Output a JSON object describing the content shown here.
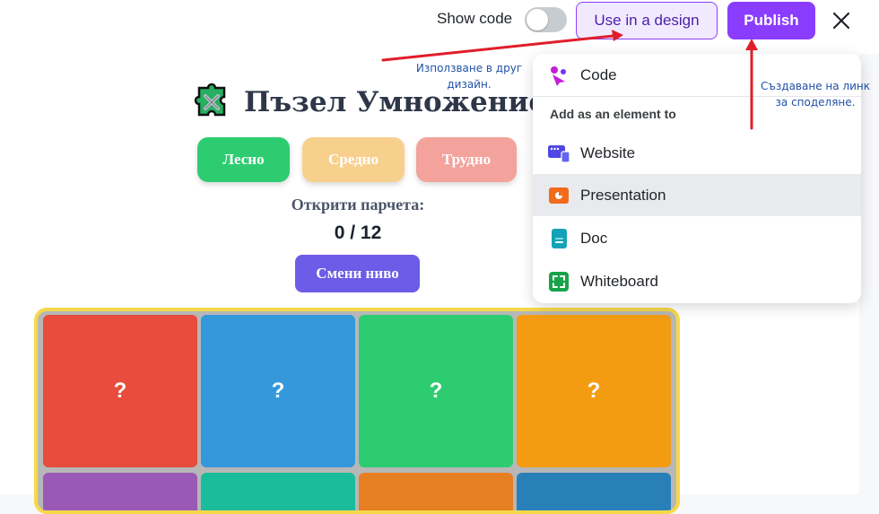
{
  "topbar": {
    "show_code_label": "Show code",
    "use_in_design_label": "Use in a design",
    "publish_label": "Publish",
    "close_icon": "close-icon",
    "colors": {
      "accent": "#8b3dff",
      "accent_soft": "#f1eaff"
    }
  },
  "game": {
    "title": "Пъзел Умножение",
    "title_icon": "puzzle-piece-icon",
    "levels": [
      "Лесно",
      "Средно",
      "Трудно"
    ],
    "found_label": "Открити парчета:",
    "score": "0 / 12",
    "change_level_label": "Смени ниво",
    "tiles": [
      {
        "label": "?",
        "color": "#e74c3c"
      },
      {
        "label": "?",
        "color": "#3498db"
      },
      {
        "label": "?",
        "color": "#2ecc71"
      },
      {
        "label": "?",
        "color": "#f39c12"
      },
      {
        "label": "",
        "color": "#9b59b6"
      },
      {
        "label": "",
        "color": "#1abc9c"
      },
      {
        "label": "",
        "color": "#e67e22"
      },
      {
        "label": "",
        "color": "#2980b9"
      }
    ]
  },
  "menu": {
    "code_label": "Code",
    "section_label": "Add as an element to",
    "items": [
      {
        "label": "Website",
        "icon": "website-icon"
      },
      {
        "label": "Presentation",
        "icon": "presentation-icon"
      },
      {
        "label": "Doc",
        "icon": "doc-icon"
      },
      {
        "label": "Whiteboard",
        "icon": "whiteboard-icon"
      }
    ],
    "highlighted": "Presentation"
  },
  "annotations": {
    "use_in_design_note": [
      "Използване в друг",
      "дизайн."
    ],
    "publish_note": [
      "Създаване на линк",
      "за споделяне."
    ]
  }
}
